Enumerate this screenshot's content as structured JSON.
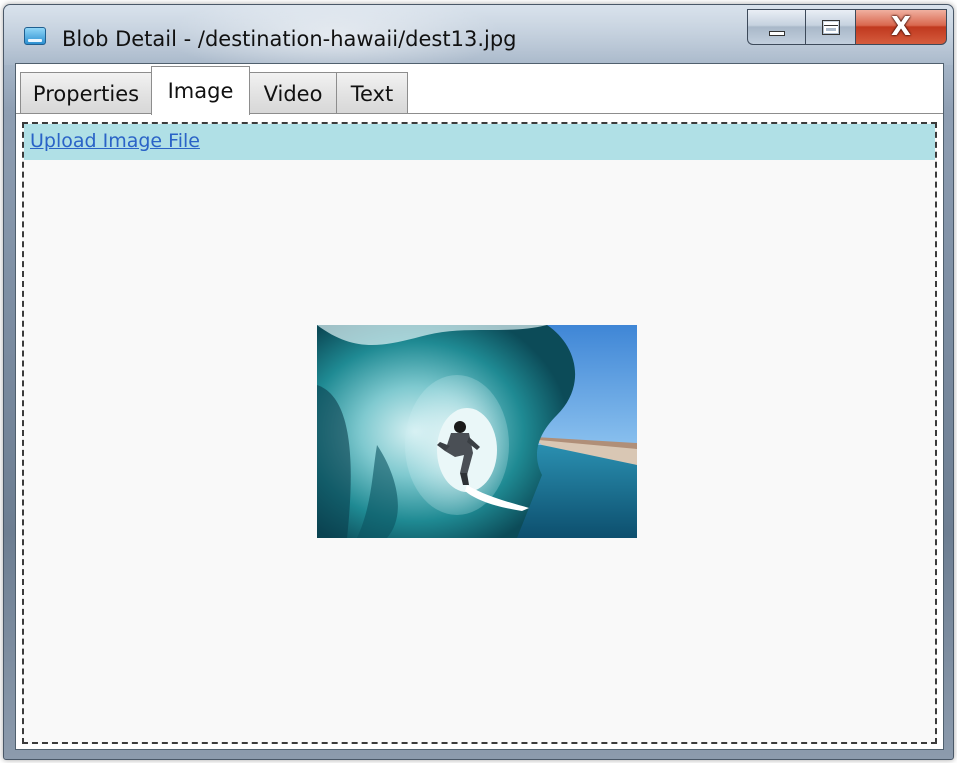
{
  "window": {
    "title": "Blob Detail - /destination-hawaii/dest13.jpg",
    "icon": "app-window-icon",
    "controls": [
      "minimize-icon",
      "maximize-icon",
      "close-icon"
    ],
    "close_glyph": "X"
  },
  "tabs": [
    {
      "label": "Properties",
      "active": false
    },
    {
      "label": "Image",
      "active": true
    },
    {
      "label": "Video",
      "active": false
    },
    {
      "label": "Text",
      "active": false
    }
  ],
  "image_tab": {
    "upload_link_label": "Upload Image File",
    "preview_image": "surfer-in-wave-photo"
  },
  "colors": {
    "upload_bar_bg": "#b0e0e6",
    "link_color": "#2a63c7",
    "close_button": "#c0391f"
  }
}
